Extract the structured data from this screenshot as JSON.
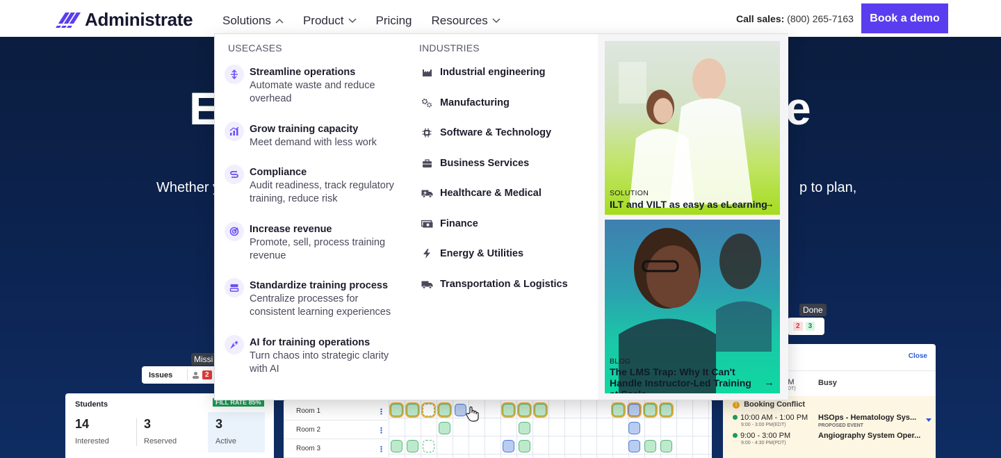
{
  "header": {
    "logo_text": "Administrate",
    "nav": [
      {
        "label": "Solutions",
        "expanded": true
      },
      {
        "label": "Product",
        "expanded": false
      },
      {
        "label": "Pricing",
        "expanded": false
      },
      {
        "label": "Resources",
        "expanded": false
      }
    ],
    "call_label": "Call sales:",
    "call_number": "(800) 265-7163",
    "cta_label": "Book a demo",
    "cta_color": "#5b3df0"
  },
  "hero": {
    "title_left_fragment": "E",
    "title_right_fragment": "e",
    "subtitle_left_fragment": "Whether y",
    "subtitle_right_fragment": "p to plan,"
  },
  "mega_menu": {
    "usecases_title": "USECASES",
    "industries_title": "INDUSTRIES",
    "usecases": [
      {
        "icon": "streamline-icon",
        "title": "Streamline operations",
        "desc": "Automate waste and reduce overhead"
      },
      {
        "icon": "growth-chart-icon",
        "title": "Grow training capacity",
        "desc": "Meet demand with less work"
      },
      {
        "icon": "compliance-icon",
        "title": "Compliance",
        "desc": "Audit readiness, track regulatory training, reduce risk"
      },
      {
        "icon": "target-icon",
        "title": "Increase revenue",
        "desc": "Promote, sell, process training revenue"
      },
      {
        "icon": "standardize-icon",
        "title": "Standardize training process",
        "desc": "Centralize processes for consistent learning experiences"
      },
      {
        "icon": "ai-sparkle-icon",
        "title": "AI for training operations",
        "desc": "Turn chaos into strategic clarity with AI"
      }
    ],
    "industries": [
      {
        "icon": "factory-icon",
        "label": "Industrial engineering"
      },
      {
        "icon": "gears-icon",
        "label": "Manufacturing"
      },
      {
        "icon": "chip-icon",
        "label": "Software & Technology"
      },
      {
        "icon": "briefcase-icon",
        "label": "Business Services"
      },
      {
        "icon": "ambulance-icon",
        "label": "Healthcare & Medical"
      },
      {
        "icon": "money-icon",
        "label": "Finance"
      },
      {
        "icon": "bolt-icon",
        "label": "Energy & Utilities"
      },
      {
        "icon": "truck-icon",
        "label": "Transportation & Logistics"
      }
    ],
    "promos": [
      {
        "kicker": "SOLUTION",
        "title": "ILT and VILT as easy as eLearning",
        "arrow": "→"
      },
      {
        "kicker": "BLOG",
        "title": "The LMS Trap: Why It Can't Handle Instructor-Led Training at Scale",
        "arrow": "→"
      }
    ]
  },
  "preview": {
    "issues_label": "Issues",
    "issues_count": "2",
    "missing_tooltip": "Missi",
    "done_tooltip": "Done",
    "done_red": "2",
    "done_green": "3",
    "students_title": "Students",
    "fill_rate": "FILL RATE 85%",
    "stats": [
      {
        "value": "14",
        "label": "Interested"
      },
      {
        "value": "3",
        "label": "Reserved"
      },
      {
        "value": "3",
        "label": "Active"
      }
    ],
    "rooms": [
      "Room 1",
      "Room 2",
      "Room 3"
    ],
    "room_menu_glyph": "⋮",
    "booking": {
      "close_label": "Close",
      "busy_label": "Busy",
      "busy_time": "AM",
      "busy_time_sub": "(PDT)",
      "conflict_title": "Booking Conflict",
      "rows": [
        {
          "time": "10:00 AM - 1:00 PM",
          "sub": "9:00 - 3:00 PM(EDT)",
          "event": "HSOps - Hematology Sys...",
          "event_sub": "PROPOSED EVENT"
        },
        {
          "time": "9:00 - 3:00 PM",
          "sub": "9:00 - 4:30 PM(PDT)",
          "event": "Angiography System Oper...",
          "event_sub": ""
        }
      ]
    }
  }
}
